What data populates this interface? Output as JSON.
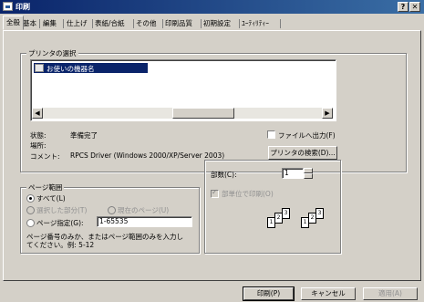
{
  "window": {
    "title": "印刷",
    "help_btn": "?",
    "close_btn": "✕"
  },
  "tabs": [
    "全般",
    "基本",
    "編集",
    "仕上げ",
    "表紙/合紙",
    "その他",
    "印刷品質",
    "初期設定",
    "ﾕｰﾃｨﾘﾃｨｰ"
  ],
  "printer_group": {
    "legend": "プリンタの選択",
    "selected_printer": "お使いの機器名",
    "status_label": "状態:",
    "status_value": "準備完了",
    "location_label": "場所:",
    "location_value": "",
    "comment_label": "コメント:",
    "comment_value": "RPCS Driver (Windows 2000/XP/Server 2003)",
    "print_to_file": "ファイルへ出力(F)",
    "find_printer": "プリンタの検索(D)..."
  },
  "page_range": {
    "legend": "ページ範囲",
    "all": "すべて(L)",
    "selection": "選択した部分(T)",
    "current": "現在のページ(U)",
    "pages": "ページ指定(G):",
    "pages_value": "1-65535",
    "hint1": "ページ番号のみか、またはページ範囲のみを入力し",
    "hint2": "てください。例: 5-12"
  },
  "copies": {
    "label": "部数(C):",
    "value": "1",
    "collate": "部単位で印刷(O)",
    "collate_pages_a": [
      "1",
      "2",
      "3"
    ],
    "collate_pages_b": [
      "1",
      "2",
      "3"
    ]
  },
  "buttons": {
    "print": "印刷(P)",
    "cancel": "キャンセル",
    "apply": "適用(A)"
  }
}
